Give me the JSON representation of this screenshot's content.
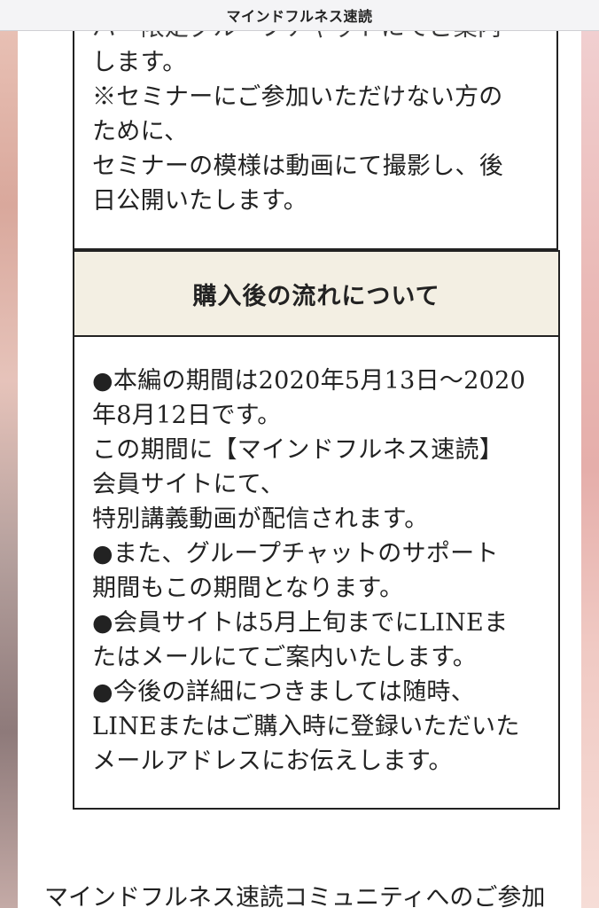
{
  "header": {
    "title": "マインドフルネス速読"
  },
  "top_section": {
    "lines": [
      "バー限定グループチャットにてご案内",
      "します。",
      "※セミナーにご参加いただけない方の",
      "ために、",
      "セミナーの模様は動画にて撮影し、後",
      "日公開いたします。"
    ]
  },
  "flow_section": {
    "heading": "購入後の流れについて",
    "lines": [
      "●本編の期間は2020年5月13日〜2020",
      "年8月12日です。",
      "この期間に【マインドフルネス速読】",
      "会員サイトにて、",
      "特別講義動画が配信されます。",
      "●また、グループチャットのサポート",
      "期間もこの期間となります。",
      "●会員サイトは5月上旬までにLINEま",
      "たはメールにてご案内いたします。",
      "●今後の詳細につきましては随時、",
      "LINEまたはご購入時に登録いただいた",
      "メールアドレスにお伝えします。"
    ]
  },
  "footer": {
    "text": "マインドフルネス速読コミュニティへのご参加"
  }
}
